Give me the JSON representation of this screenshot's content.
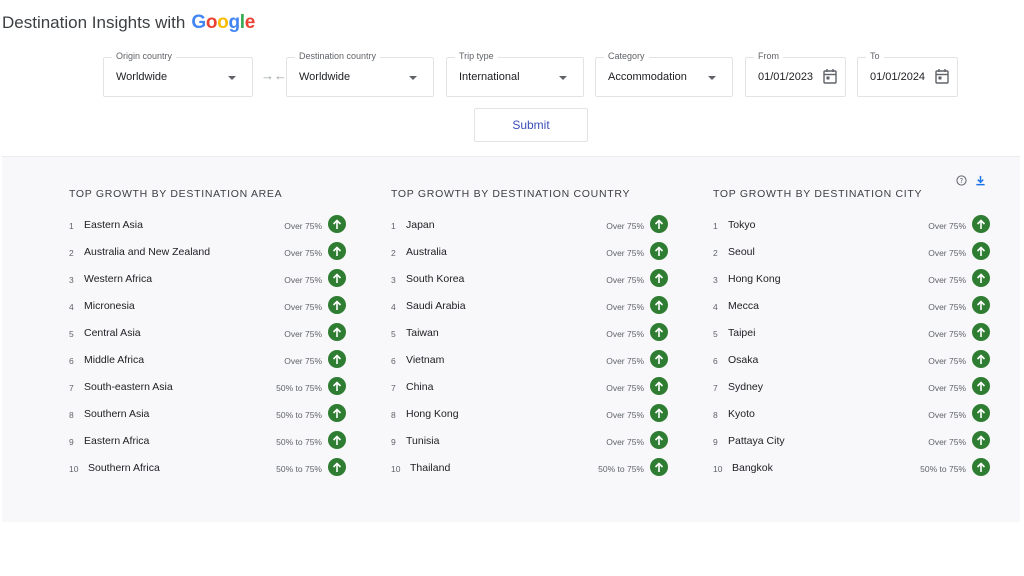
{
  "header": {
    "title": "Destination Insights with",
    "logo_letters": [
      "G",
      "o",
      "o",
      "g",
      "l",
      "e"
    ]
  },
  "filters": {
    "origin": {
      "label": "Origin country",
      "value": "Worldwide"
    },
    "destination": {
      "label": "Destination country",
      "value": "Worldwide"
    },
    "trip_type": {
      "label": "Trip type",
      "value": "International"
    },
    "category": {
      "label": "Category",
      "value": "Accommodation"
    },
    "from": {
      "label": "From",
      "value": "01/01/2023"
    },
    "to": {
      "label": "To",
      "value": "01/01/2024"
    },
    "submit_label": "Submit"
  },
  "icons": {
    "swap": "swap-icon",
    "calendar": "calendar-icon",
    "help": "help-icon",
    "download": "download-icon",
    "growth": "arrow-up-icon"
  },
  "colors": {
    "accent": "#3c4eb8",
    "growth_badge": "#2e7d32",
    "panel_bg": "#f8f8fa"
  },
  "areas": {
    "title": "TOP GROWTH BY DESTINATION AREA",
    "items": [
      {
        "rank": "1",
        "name": "Eastern Asia",
        "growth": "Over 75%"
      },
      {
        "rank": "2",
        "name": "Australia and New Zealand",
        "growth": "Over 75%"
      },
      {
        "rank": "3",
        "name": "Western Africa",
        "growth": "Over 75%"
      },
      {
        "rank": "4",
        "name": "Micronesia",
        "growth": "Over 75%"
      },
      {
        "rank": "5",
        "name": "Central Asia",
        "growth": "Over 75%"
      },
      {
        "rank": "6",
        "name": "Middle Africa",
        "growth": "Over 75%"
      },
      {
        "rank": "7",
        "name": "South-eastern Asia",
        "growth": "50% to 75%"
      },
      {
        "rank": "8",
        "name": "Southern Asia",
        "growth": "50% to 75%"
      },
      {
        "rank": "9",
        "name": "Eastern Africa",
        "growth": "50% to 75%"
      },
      {
        "rank": "10",
        "name": "Southern Africa",
        "growth": "50% to 75%"
      }
    ]
  },
  "countries": {
    "title": "TOP GROWTH BY DESTINATION COUNTRY",
    "items": [
      {
        "rank": "1",
        "name": "Japan",
        "growth": "Over 75%"
      },
      {
        "rank": "2",
        "name": "Australia",
        "growth": "Over 75%"
      },
      {
        "rank": "3",
        "name": "South Korea",
        "growth": "Over 75%"
      },
      {
        "rank": "4",
        "name": "Saudi Arabia",
        "growth": "Over 75%"
      },
      {
        "rank": "5",
        "name": "Taiwan",
        "growth": "Over 75%"
      },
      {
        "rank": "6",
        "name": "Vietnam",
        "growth": "Over 75%"
      },
      {
        "rank": "7",
        "name": "China",
        "growth": "Over 75%"
      },
      {
        "rank": "8",
        "name": "Hong Kong",
        "growth": "Over 75%"
      },
      {
        "rank": "9",
        "name": "Tunisia",
        "growth": "Over 75%"
      },
      {
        "rank": "10",
        "name": "Thailand",
        "growth": "50% to 75%"
      }
    ]
  },
  "cities": {
    "title": "TOP GROWTH BY DESTINATION CITY",
    "items": [
      {
        "rank": "1",
        "name": "Tokyo",
        "growth": "Over 75%"
      },
      {
        "rank": "2",
        "name": "Seoul",
        "growth": "Over 75%"
      },
      {
        "rank": "3",
        "name": "Hong Kong",
        "growth": "Over 75%"
      },
      {
        "rank": "4",
        "name": "Mecca",
        "growth": "Over 75%"
      },
      {
        "rank": "5",
        "name": "Taipei",
        "growth": "Over 75%"
      },
      {
        "rank": "6",
        "name": "Osaka",
        "growth": "Over 75%"
      },
      {
        "rank": "7",
        "name": "Sydney",
        "growth": "Over 75%"
      },
      {
        "rank": "8",
        "name": "Kyoto",
        "growth": "Over 75%"
      },
      {
        "rank": "9",
        "name": "Pattaya City",
        "growth": "Over 75%"
      },
      {
        "rank": "10",
        "name": "Bangkok",
        "growth": "50% to 75%"
      }
    ]
  }
}
